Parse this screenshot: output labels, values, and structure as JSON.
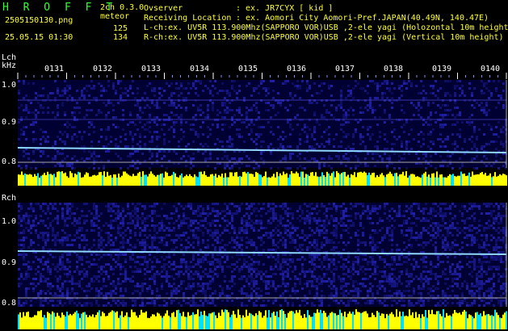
{
  "header": {
    "app_name": "H R O F F T",
    "version": "2ch 0.3.0",
    "file_name": "2505150130.png",
    "mode": "meteor",
    "date_time": "25.05.15 01:30",
    "lch_count": "125",
    "rch_count": "134",
    "observer_label": "Ovserver",
    "observer_value": ": ex. JR7CYX [ kid ]",
    "location_label": "Receiving Location",
    "location_value": ": ex. Aomori City Aomori-Pref.JAPAN(40.49N, 140.47E)",
    "lch_info": "L-ch:ex. UV5R 113.900Mhz(SAPPORO VOR)USB ,2-ele yagi (Holozontal 10m height)",
    "rch_info": "R-ch:ex. UV5R 113.900Mhz(SAPPORO VOR)USB ,2-ele yagi (Vertical 10m height)"
  },
  "time_ticks": [
    "0131",
    "0132",
    "0133",
    "0134",
    "0135",
    "0136",
    "0137",
    "0138",
    "0139",
    "0140"
  ],
  "lch": {
    "label": "Lch",
    "unit": "kHz",
    "yticks": [
      "1.0",
      "0.9",
      "0.8"
    ]
  },
  "rch": {
    "label": "Rch",
    "yticks": [
      "1.0",
      "0.9",
      "0.8"
    ]
  },
  "colors": {
    "brand": "#33ff33",
    "text": "#ffffff",
    "background": "#000000",
    "noise_dark": "#000033",
    "noise_blue": "#1a1aa6",
    "trace": "#8fd8ff",
    "level_yellow": "#ffff00",
    "level_cyan": "#00e0ff",
    "grid_blue": "#2a2ad0"
  }
}
